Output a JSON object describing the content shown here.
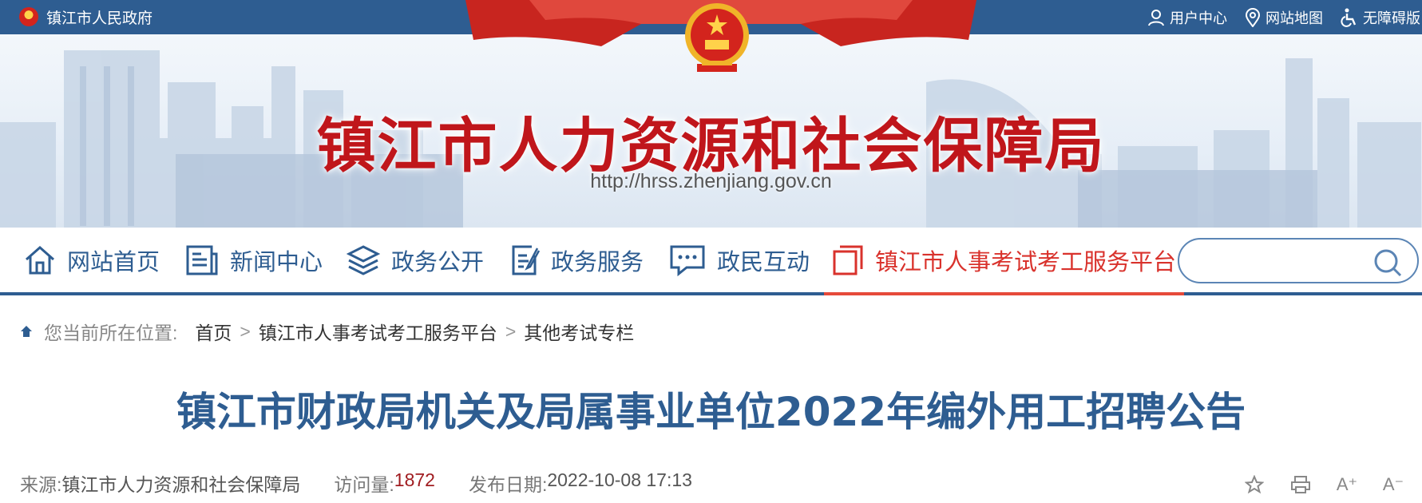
{
  "topbar": {
    "gov_name": "镇江市人民政府",
    "links": [
      {
        "label": "用户中心",
        "icon": "user-icon"
      },
      {
        "label": "网站地图",
        "icon": "map-pin-icon"
      },
      {
        "label": "无障碍版",
        "icon": "accessibility-icon"
      }
    ]
  },
  "banner": {
    "title": "镇江市人力资源和社会保障局",
    "url": "http://hrss.zhenjiang.gov.cn"
  },
  "nav": {
    "items": [
      {
        "label": "网站首页",
        "icon": "home-icon"
      },
      {
        "label": "新闻中心",
        "icon": "news-icon"
      },
      {
        "label": "政务公开",
        "icon": "layers-icon"
      },
      {
        "label": "政务服务",
        "icon": "document-edit-icon"
      },
      {
        "label": "政民互动",
        "icon": "chat-icon"
      },
      {
        "label": "镇江市人事考试考工服务平台",
        "icon": "copy-icon",
        "active": true
      }
    ],
    "search_placeholder": ""
  },
  "breadcrumb": {
    "label": "您当前所在位置:",
    "items": [
      "首页",
      "镇江市人事考试考工服务平台",
      "其他考试专栏"
    ],
    "separator": ">"
  },
  "article": {
    "title": "镇江市财政局机关及局属事业单位2022年编外用工招聘公告",
    "source_label": "来源:",
    "source": "镇江市人力资源和社会保障局",
    "views_label": "访问量:",
    "views": "1872",
    "date_label": "发布日期:",
    "date": "2022-10-08 17:13"
  },
  "tools": [
    {
      "icon": "star-icon"
    },
    {
      "icon": "print-icon"
    },
    {
      "icon": "font-increase-icon",
      "text": "A⁺"
    },
    {
      "icon": "font-decrease-icon",
      "text": "A⁻"
    }
  ],
  "colors": {
    "brand_blue": "#2e5d91",
    "title_red": "#c0161b",
    "active_red": "#d9322c",
    "views_red": "#a01c20"
  }
}
